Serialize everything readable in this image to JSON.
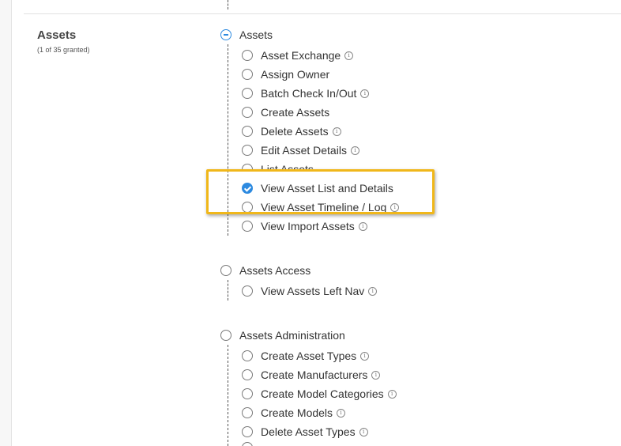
{
  "sections": {
    "assets": {
      "title": "Assets",
      "subtitle": "(1 of 35 granted)",
      "group_label": "Assets",
      "items": [
        {
          "label": "Asset Exchange",
          "info": true,
          "checked": false
        },
        {
          "label": "Assign Owner",
          "info": false,
          "checked": false
        },
        {
          "label": "Batch Check In/Out",
          "info": true,
          "checked": false
        },
        {
          "label": "Create Assets",
          "info": false,
          "checked": false
        },
        {
          "label": "Delete Assets",
          "info": true,
          "checked": false
        },
        {
          "label": "Edit Asset Details",
          "info": true,
          "checked": false
        },
        {
          "label": "List Assets",
          "info": false,
          "checked": false
        },
        {
          "label": "View Asset List and Details",
          "info": false,
          "checked": true
        },
        {
          "label": "View Asset Timeline / Log",
          "info": true,
          "checked": false
        },
        {
          "label": "View Import Assets",
          "info": true,
          "checked": false
        }
      ]
    },
    "assets_access": {
      "group_label": "Assets Access",
      "items": [
        {
          "label": "View Assets Left Nav",
          "info": true,
          "checked": false
        }
      ]
    },
    "assets_administration": {
      "group_label": "Assets Administration",
      "items": [
        {
          "label": "Create Asset Types",
          "info": true,
          "checked": false
        },
        {
          "label": "Create Manufacturers",
          "info": true,
          "checked": false
        },
        {
          "label": "Create Model Categories",
          "info": true,
          "checked": false
        },
        {
          "label": "Create Models",
          "info": true,
          "checked": false
        },
        {
          "label": "Delete Asset Types",
          "info": true,
          "checked": false
        }
      ]
    }
  },
  "info_glyph": "i",
  "colors": {
    "accent": "#2d8ae0",
    "highlight": "#f0b71a"
  }
}
